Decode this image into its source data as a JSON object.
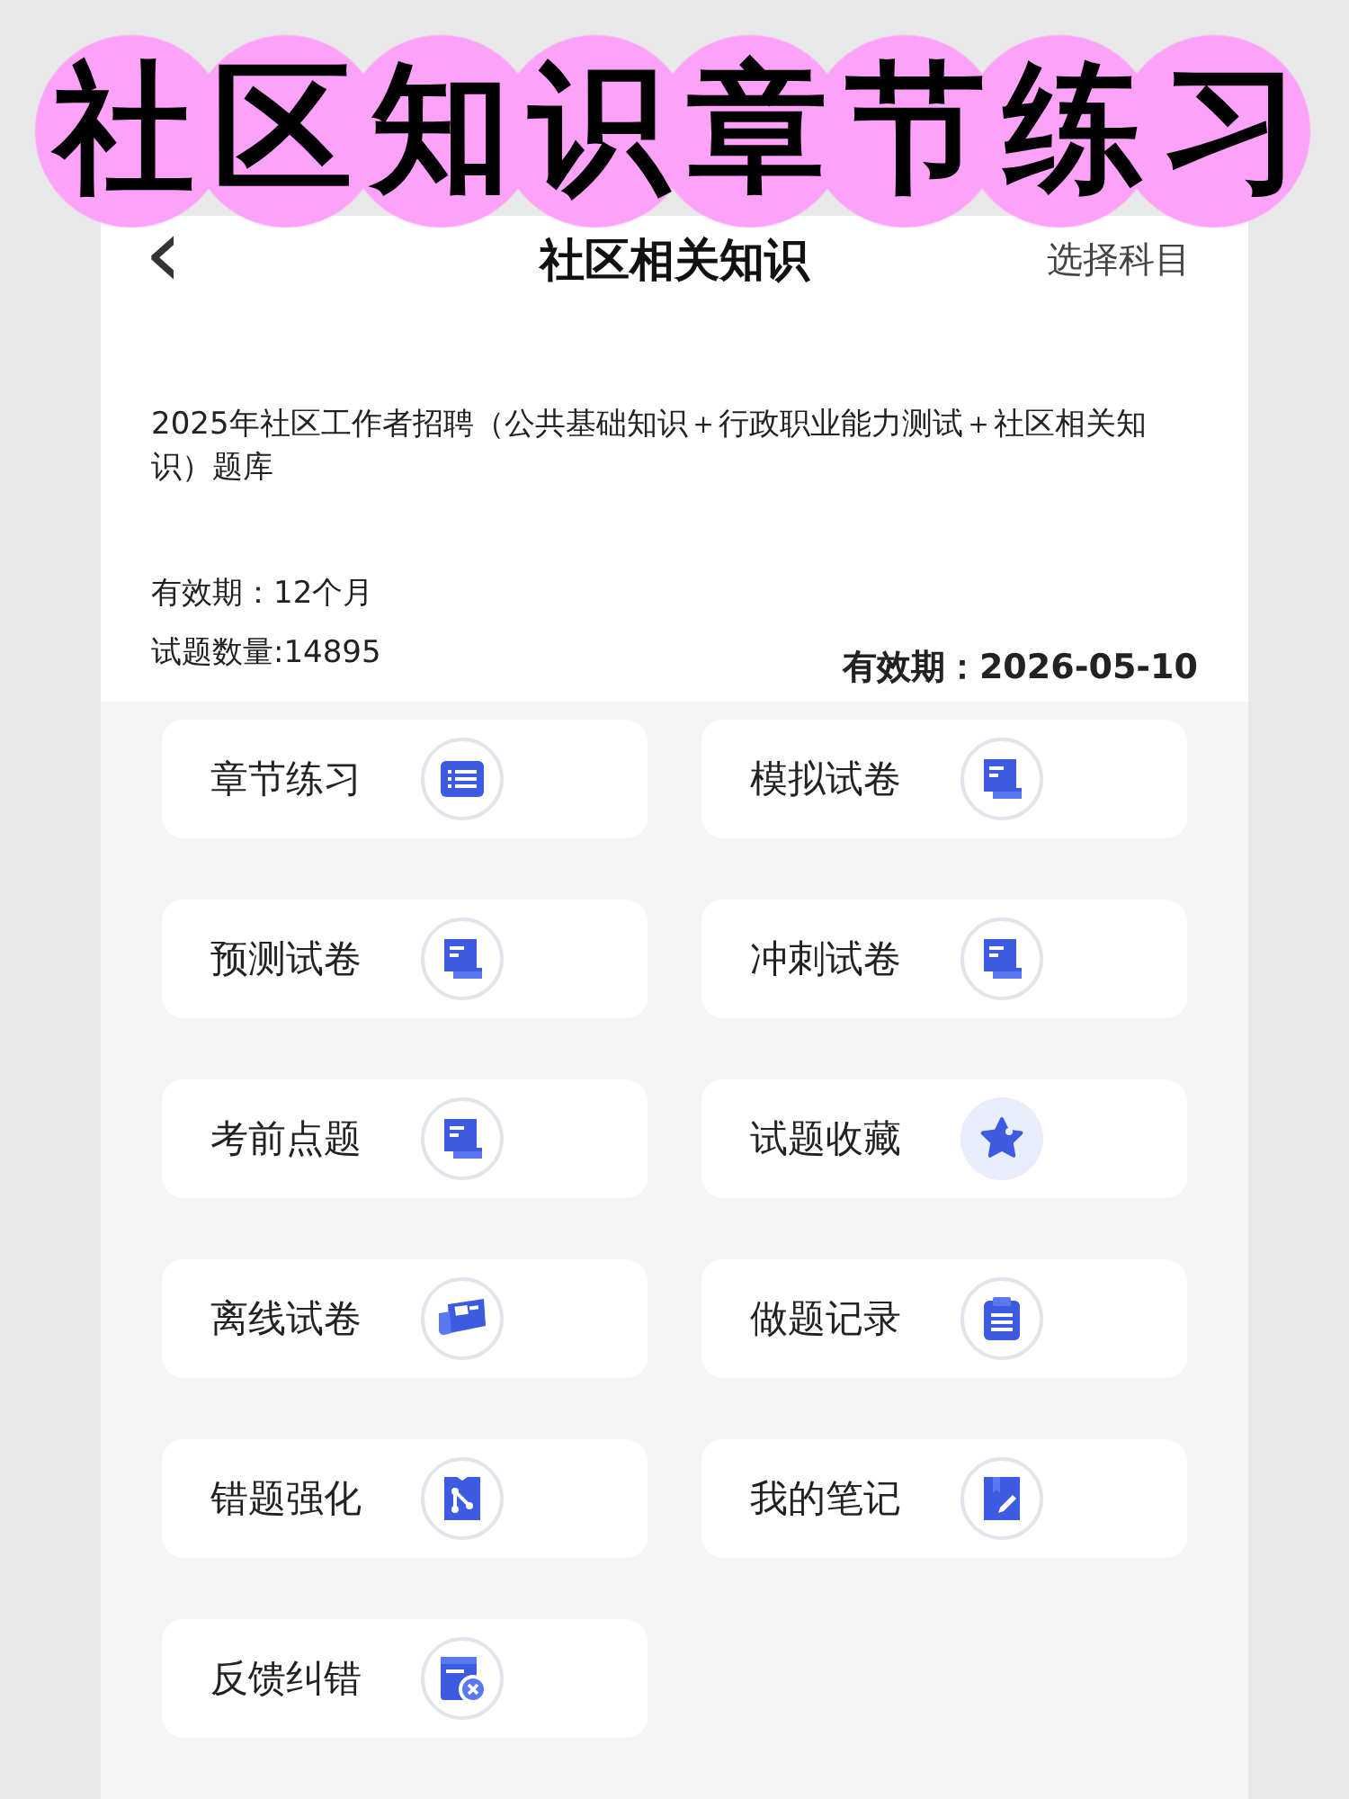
{
  "banner": {
    "title": "社区知识章节练习"
  },
  "nav": {
    "back": "‹",
    "title": "社区相关知识",
    "action": "选择科目"
  },
  "course": {
    "name": "2025年社区工作者招聘（公共基础知识＋行政职业能力测试＋社区相关知识）题库",
    "validity": "有效期：12个月",
    "count": "试题数量:14895",
    "expiry": "有效期：2026-05-10"
  },
  "menu": [
    {
      "label": "章节练习",
      "kind": "list"
    },
    {
      "label": "模拟试卷",
      "kind": "paper"
    },
    {
      "label": "预测试卷",
      "kind": "paper"
    },
    {
      "label": "冲刺试卷",
      "kind": "paper"
    },
    {
      "label": "考前点题",
      "kind": "paper"
    },
    {
      "label": "试题收藏",
      "kind": "star"
    },
    {
      "label": "离线试卷",
      "kind": "news"
    },
    {
      "label": "做题记录",
      "kind": "clipboard"
    },
    {
      "label": "错题强化",
      "kind": "branch"
    },
    {
      "label": "我的笔记",
      "kind": "note"
    },
    {
      "label": "反馈纠错",
      "kind": "feedback"
    }
  ]
}
